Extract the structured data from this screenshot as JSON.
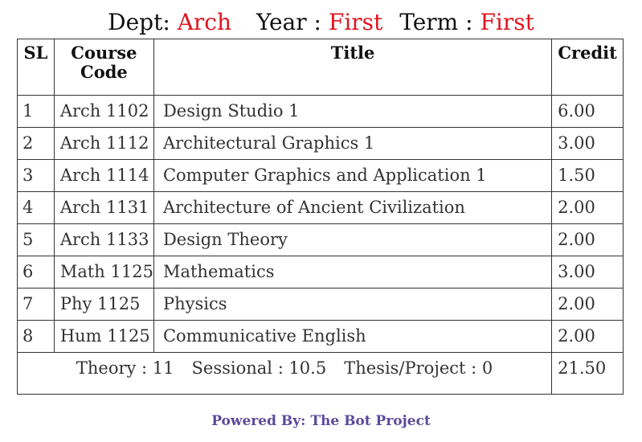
{
  "header": {
    "dept_label": "Dept:",
    "dept_value": "Arch",
    "year_label": "Year :",
    "year_value": "First",
    "term_label": "Term :",
    "term_value": "First"
  },
  "table": {
    "columns": {
      "sl": "SL",
      "code": "Course Code",
      "title": "Title",
      "credit": "Credit"
    },
    "rows": [
      {
        "sl": "1",
        "code": "Arch 1102",
        "title": "Design Studio 1",
        "credit": "6.00"
      },
      {
        "sl": "2",
        "code": "Arch 1112",
        "title": "Architectural Graphics 1",
        "credit": "3.00"
      },
      {
        "sl": "3",
        "code": "Arch 1114",
        "title": "Computer Graphics and Application 1",
        "credit": "1.50"
      },
      {
        "sl": "4",
        "code": "Arch 1131",
        "title": "Architecture of Ancient Civilization",
        "credit": "2.00"
      },
      {
        "sl": "5",
        "code": "Arch 1133",
        "title": "Design Theory",
        "credit": "2.00"
      },
      {
        "sl": "6",
        "code": "Math 1125",
        "title": "Mathematics",
        "credit": "3.00"
      },
      {
        "sl": "7",
        "code": "Phy 1125",
        "title": "Physics",
        "credit": "2.00"
      },
      {
        "sl": "8",
        "code": "Hum 1125",
        "title": "Communicative English",
        "credit": "2.00"
      }
    ],
    "summary": {
      "theory": "Theory : 11",
      "sessional": "Sessional : 10.5",
      "thesis": "Thesis/Project : 0",
      "total": "21.50"
    }
  },
  "footer": {
    "powered_by": "Powered By: The Bot Project"
  }
}
